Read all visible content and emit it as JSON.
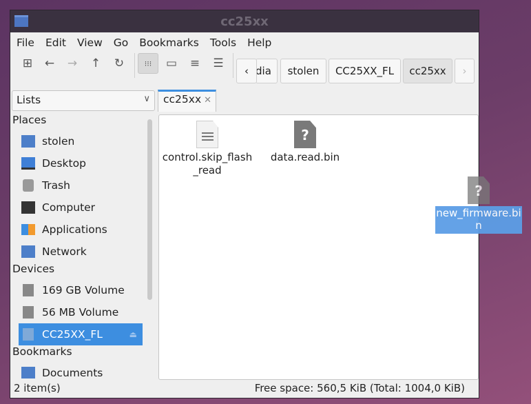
{
  "window": {
    "title": "cc25xx"
  },
  "menu": [
    "File",
    "Edit",
    "View",
    "Go",
    "Bookmarks",
    "Tools",
    "Help"
  ],
  "breadcrumbs": [
    "dia",
    "stolen",
    "CC25XX_FL",
    "cc25xx"
  ],
  "side_pane_mode": "Lists",
  "tab": {
    "label": "cc25xx"
  },
  "sidebar": {
    "places_label": "Places",
    "places": [
      "stolen",
      "Desktop",
      "Trash",
      "Computer",
      "Applications",
      "Network"
    ],
    "devices_label": "Devices",
    "devices": [
      "169 GB Volume",
      "56 MB Volume",
      "CC25XX_FL"
    ],
    "bookmarks_label": "Bookmarks",
    "bookmarks": [
      "Documents"
    ]
  },
  "files": [
    {
      "name": "control.skip_flash\n_read",
      "icon": "text-file-icon"
    },
    {
      "name": "data.read.bin",
      "icon": "unknown-file-icon"
    }
  ],
  "drag_item": {
    "name": "new_firmware.bi\nn",
    "glyph": "?"
  },
  "status": {
    "count": "2 item(s)",
    "free": "Free space: 560,5 KiB (Total: 1004,0 KiB)"
  },
  "colors": {
    "accent": "#3d8ee0",
    "titlebar": "#3a3140"
  }
}
